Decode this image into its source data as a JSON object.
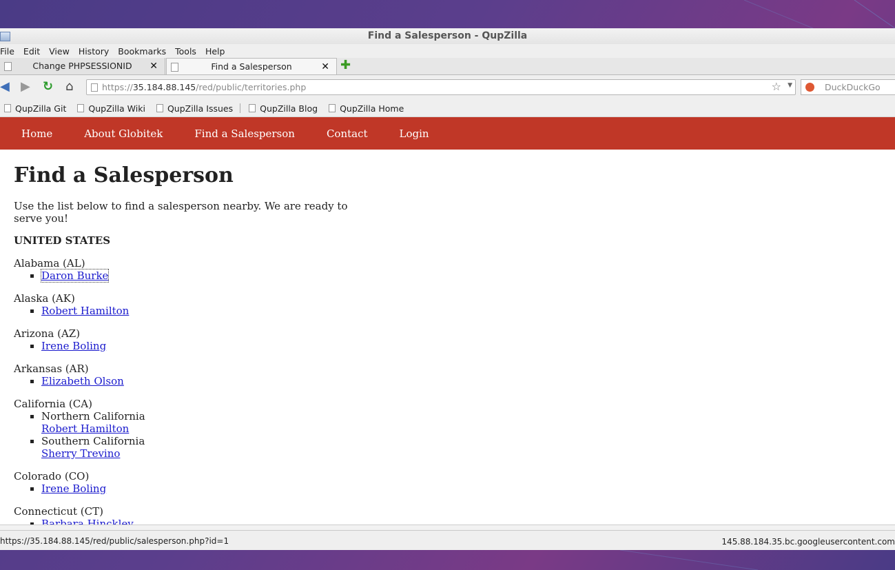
{
  "window": {
    "title": "Find a Salesperson - QupZilla"
  },
  "menu": [
    "File",
    "Edit",
    "View",
    "History",
    "Bookmarks",
    "Tools",
    "Help"
  ],
  "tabs": [
    {
      "label": "Change PHPSESSIONID",
      "active": false
    },
    {
      "label": "Find a Salesperson",
      "active": true
    }
  ],
  "address": {
    "scheme": "https://",
    "host": "35.184.88.145",
    "path": "/red/public/territories.php"
  },
  "search": {
    "placeholder": "DuckDuckGo"
  },
  "bookmarks": [
    "QupZilla Git",
    "QupZilla Wiki",
    "QupZilla Issues",
    "QupZilla Blog",
    "QupZilla Home"
  ],
  "site_nav": [
    "Home",
    "About Globitek",
    "Find a Salesperson",
    "Contact",
    "Login"
  ],
  "page": {
    "heading": "Find a Salesperson",
    "intro": "Use the list below to find a salesperson nearby. We are ready to serve you!",
    "country": "UNITED STATES"
  },
  "states": [
    {
      "name": "Alabama (AL)",
      "items": [
        {
          "sub": "",
          "person": "Daron Burke"
        }
      ]
    },
    {
      "name": "Alaska (AK)",
      "items": [
        {
          "sub": "",
          "person": "Robert Hamilton"
        }
      ]
    },
    {
      "name": "Arizona (AZ)",
      "items": [
        {
          "sub": "",
          "person": "Irene Boling"
        }
      ]
    },
    {
      "name": "Arkansas (AR)",
      "items": [
        {
          "sub": "",
          "person": "Elizabeth Olson"
        }
      ]
    },
    {
      "name": "California (CA)",
      "items": [
        {
          "sub": "Northern California",
          "person": "Robert Hamilton"
        },
        {
          "sub": "Southern California",
          "person": "Sherry Trevino"
        }
      ]
    },
    {
      "name": "Colorado (CO)",
      "items": [
        {
          "sub": "",
          "person": "Irene Boling"
        }
      ]
    },
    {
      "name": "Connecticut (CT)",
      "items": [
        {
          "sub": "",
          "person": "Barbara Hinckley"
        }
      ]
    }
  ],
  "status": {
    "left": "https://35.184.88.145/red/public/salesperson.php?id=1",
    "right": "145.88.184.35.bc.googleusercontent.com"
  },
  "colors": {
    "site_nav_bg": "#c03727",
    "link": "#1a1acd"
  }
}
